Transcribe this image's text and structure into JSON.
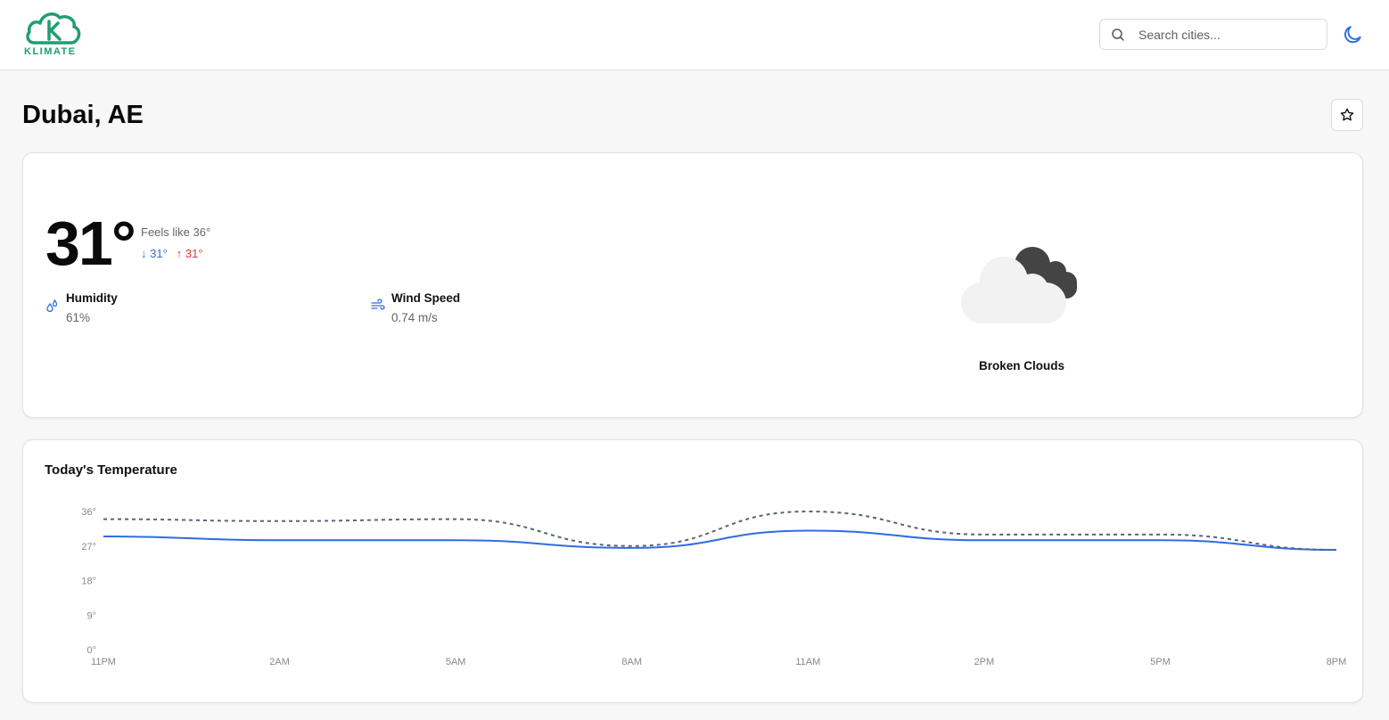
{
  "header": {
    "logo_text": "KLIMATE",
    "search_placeholder": "Search cities...",
    "accent_color": "#2e6de0"
  },
  "location": {
    "title": "Dubai, AE"
  },
  "current": {
    "temperature": "31°",
    "feels_like": "Feels like 36°",
    "min": "↓ 31°",
    "max": "↑ 31°",
    "humidity_label": "Humidity",
    "humidity_value": "61%",
    "wind_label": "Wind Speed",
    "wind_value": "0.74 m/s",
    "description": "Broken Clouds",
    "icon": "broken-clouds-icon"
  },
  "chart": {
    "title": "Today's Temperature"
  },
  "chart_data": {
    "type": "line",
    "title": "Today's Temperature",
    "categories": [
      "11PM",
      "2AM",
      "5AM",
      "8AM",
      "11AM",
      "2PM",
      "5PM",
      "8PM"
    ],
    "y_ticks": [
      "0°",
      "9°",
      "18°",
      "27°",
      "36°"
    ],
    "ylim": [
      0,
      36
    ],
    "series": [
      {
        "values": [
          29.5,
          28.5,
          28.5,
          26.5,
          31,
          28.5,
          28.5,
          26
        ],
        "color": "#2e6de0",
        "style": "solid"
      },
      {
        "values": [
          34,
          33.5,
          34,
          27,
          36,
          30,
          30,
          26
        ],
        "color": "#5a6478",
        "style": "dashed"
      }
    ],
    "grid": false,
    "legend": "none"
  }
}
